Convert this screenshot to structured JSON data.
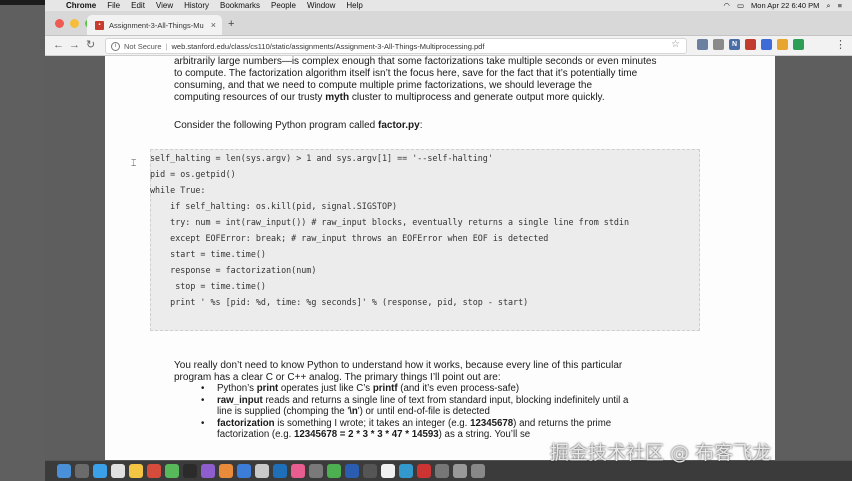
{
  "menubar": {
    "apple": "",
    "items": [
      "Chrome",
      "File",
      "Edit",
      "View",
      "History",
      "Bookmarks",
      "People",
      "Window",
      "Help"
    ],
    "clock": "Mon Apr 22  6:40 PM"
  },
  "tab": {
    "title": "Assignment-3-All-Things-Mu",
    "close": "×",
    "new_tab": "+"
  },
  "toolbar": {
    "back": "←",
    "forward": "→",
    "reload": "↻",
    "secure_label": "Not Secure",
    "separator": "|",
    "url": "web.stanford.edu/class/cs110/static/assignments/Assignment-3-All-Things-Multiprocessing.pdf",
    "menu": "⋮"
  },
  "document": {
    "para1_lines": [
      "arbitrarily large numbers—is complex enough that some factorizations take multiple seconds or even minutes",
      "to compute.  The factorization algorithm itself isn’t the focus here, save for the fact that it’s potentially time",
      "consuming, and that we need to compute multiple prime factorizations, we should leverage the"
    ],
    "para1_last_pre": "computing resources of our trusty ",
    "para1_last_bold": "myth",
    "para1_last_post": " cluster to multiprocess and generate output more quickly.",
    "para2_pre": "Consider the following Python program called ",
    "para2_bold": "factor.py",
    "para2_post": ":",
    "code_lines": [
      "self_halting = len(sys.argv) > 1 and sys.argv[1] == '--self-halting'",
      "pid = os.getpid()",
      "while True:",
      "    if self_halting: os.kill(pid, signal.SIGSTOP)",
      "    try: num = int(raw_input()) # raw_input blocks, eventually returns a single line from stdin",
      "    except EOFError: break; # raw_input throws an EOFError when EOF is detected",
      "    start = time.time()",
      "    response = factorization(num)",
      "     stop = time.time()",
      "    print ' %s [pid: %d, time: %g seconds]' % (response, pid, stop - start)"
    ],
    "para3_lines": [
      "You really don’t need to know Python to understand how it works, because every line of this particular",
      "program has a clear C or C++ analog.  The primary things I’ll point out are:"
    ],
    "bullet1": {
      "a": "Python’s ",
      "b": "print",
      "c": " operates just like C’s ",
      "d": "printf",
      "e": " (and it’s even process-safe)"
    },
    "bullet2": {
      "b": "raw_input",
      "c": " reads and returns a single line of text from standard input, blocking indefinitely until a",
      "line2a": "line is supplied (chomping the '",
      "line2b": "\\n",
      "line2c": "') or until end-of-file is detected"
    },
    "bullet3": {
      "b": "factorization",
      "c": " is something I wrote; it takes an integer (e.g. ",
      "d": "12345678",
      "e": ") and returns the prime",
      "line2a": "factorization (e.g. ",
      "line2b": "12345678 = 2 * 3 * 3 * 47 * 14593",
      "line2c": ") as a string.  You’ll se"
    }
  },
  "watermark": "掘金技术社区 @ 布客飞龙"
}
